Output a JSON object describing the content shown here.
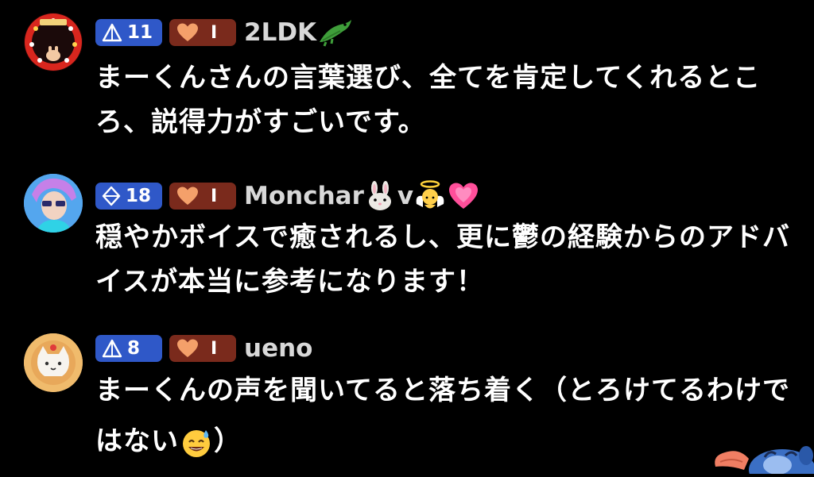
{
  "comments": [
    {
      "level": "11",
      "fan_level": "I",
      "username": "2LDK",
      "username_emojis": [
        "crocodile-emoji"
      ],
      "text": "まーくんさんの言葉選び、全てを肯定してくれるところ、説得力がすごいです。"
    },
    {
      "level": "18",
      "fan_level": "I",
      "username": "Monchar",
      "username_emojis": [
        "rabbit-face-emoji"
      ],
      "username_suffix": "v",
      "username_emojis_after": [
        "angel-emoji",
        "growing-heart-emoji"
      ],
      "text": "穏やかボイスで癒されるし、更に鬱の経験からのアドバイスが本当に参考になります！"
    },
    {
      "level": "8",
      "fan_level": "I",
      "username": "ueno",
      "text": "まーくんの声を聞いてると落ち着く（とろけてるわけではない",
      "text_end": "）",
      "text_emoji": "sweat-smile-emoji"
    }
  ],
  "colors": {
    "background": "#000000",
    "level_badge": "#2f58c8",
    "fan_badge": "#7a2a1c",
    "username": "#d8d8d8",
    "message": "#ffffff",
    "heart": "#f4a06a"
  }
}
